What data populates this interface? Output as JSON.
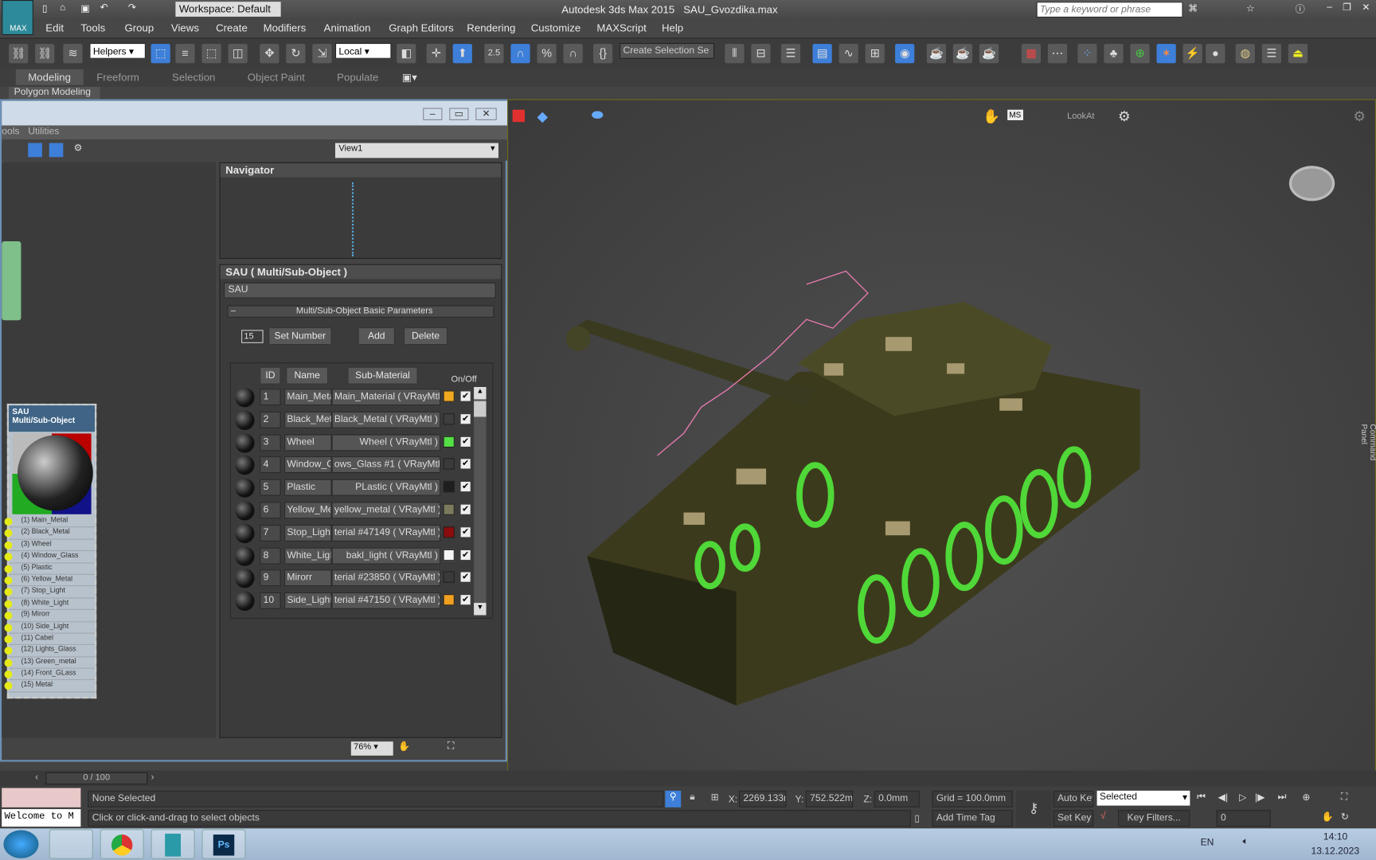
{
  "app": {
    "title": "Autodesk 3ds Max  2015",
    "file": "SAU_Gvozdika.max",
    "logo_label": "MAX",
    "workspace": "Workspace: Default",
    "search_placeholder": "Type a keyword or phrase"
  },
  "menu": [
    "Edit",
    "Tools",
    "Group",
    "Views",
    "Create",
    "Modifiers",
    "Animation",
    "Graph Editors",
    "Rendering",
    "Customize",
    "MAXScript",
    "Help"
  ],
  "toolbar": {
    "filter": "Helpers",
    "coord": "Local",
    "snap_angle": "2.5",
    "selection_set": "Create Selection Se"
  },
  "ribbon": {
    "tabs": [
      "Modeling",
      "Freeform",
      "Selection",
      "Object Paint",
      "Populate"
    ],
    "active": "Modeling",
    "subpanel": "Polygon Modeling"
  },
  "viewport": {
    "lookat": "LookAt",
    "command_panel": "Command Panel"
  },
  "slate": {
    "menu": [
      "ools",
      "Utilities"
    ],
    "view_select": "View1",
    "navigator_title": "Navigator",
    "zoom": "76%",
    "node": {
      "title": "SAU",
      "type": "Multi/Sub-Object",
      "slots": [
        "(1) Main_Metal",
        "(2) Black_Metal",
        "(3) Wheel",
        "(4) Window_Glass",
        "(5) Plastic",
        "(6) Yellow_Metal",
        "(7) Stop_Light",
        "(8) White_Light",
        "(9) Mirorr",
        "(10) Side_Light",
        "(11) Cabel",
        "(12) Lights_Glass",
        "(13) Green_metal",
        "(14) Front_GLass",
        "(15) Metal"
      ]
    },
    "params": {
      "title": "SAU  ( Multi/Sub-Object )",
      "name_field": "SAU",
      "rollout": "Multi/Sub-Object Basic Parameters",
      "count": "15",
      "set_number": "Set Number",
      "add": "Add",
      "delete": "Delete",
      "headers": {
        "id": "ID",
        "name": "Name",
        "sub": "Sub-Material",
        "onoff": "On/Off"
      },
      "rows": [
        {
          "id": "1",
          "name": "Main_Meta",
          "sub": "Main_Material  ( VRayMtl )",
          "color": "#f0a820"
        },
        {
          "id": "2",
          "name": "Black_Meta",
          "sub": "Black_Metal  ( VRayMtl )",
          "color": "#3e3e3e"
        },
        {
          "id": "3",
          "name": "Wheel",
          "sub": "Wheel  ( VRayMtl )",
          "color": "#55e045"
        },
        {
          "id": "4",
          "name": "Window_G",
          "sub": "ows_Glass #1  ( VRayMtl )",
          "color": "#3a3a3a"
        },
        {
          "id": "5",
          "name": "Plastic",
          "sub": "PLastic  ( VRayMtl )",
          "color": "#1e1e1e"
        },
        {
          "id": "6",
          "name": "Yellow_Me",
          "sub": "yellow_metal  ( VRayMtl )",
          "color": "#7c7a5c"
        },
        {
          "id": "7",
          "name": "Stop_Light",
          "sub": "terial #47149  ( VRayMtl )",
          "color": "#8a0c0c"
        },
        {
          "id": "8",
          "name": "White_Ligh",
          "sub": "bakl_light  ( VRayMtl )",
          "color": "#f4f4f4"
        },
        {
          "id": "9",
          "name": "Mirorr",
          "sub": "terial #23850  ( VRayMtl )",
          "color": "#3a3a3a"
        },
        {
          "id": "10",
          "name": "Side_Light",
          "sub": "terial #47150  ( VRayMtl )",
          "color": "#f0a020"
        }
      ]
    }
  },
  "timeline": {
    "frame": "0 / 100"
  },
  "status": {
    "listener": "Welcome to M",
    "selection": "None Selected",
    "prompt": "Click or click-and-drag to select objects",
    "x": "2269.133m",
    "y": "752.522mm",
    "z": "0.0mm",
    "grid": "Grid = 100.0mm",
    "auto_key": "Auto Key",
    "set_key": "Set Key",
    "key_mode": "Selected",
    "key_filters": "Key Filters...",
    "add_time_tag": "Add Time Tag",
    "frame": "0",
    "x_label": "X:",
    "y_label": "Y:",
    "z_label": "Z:"
  },
  "taskbar": {
    "lang": "EN",
    "time": "14:10",
    "date": "13.12.2023"
  }
}
